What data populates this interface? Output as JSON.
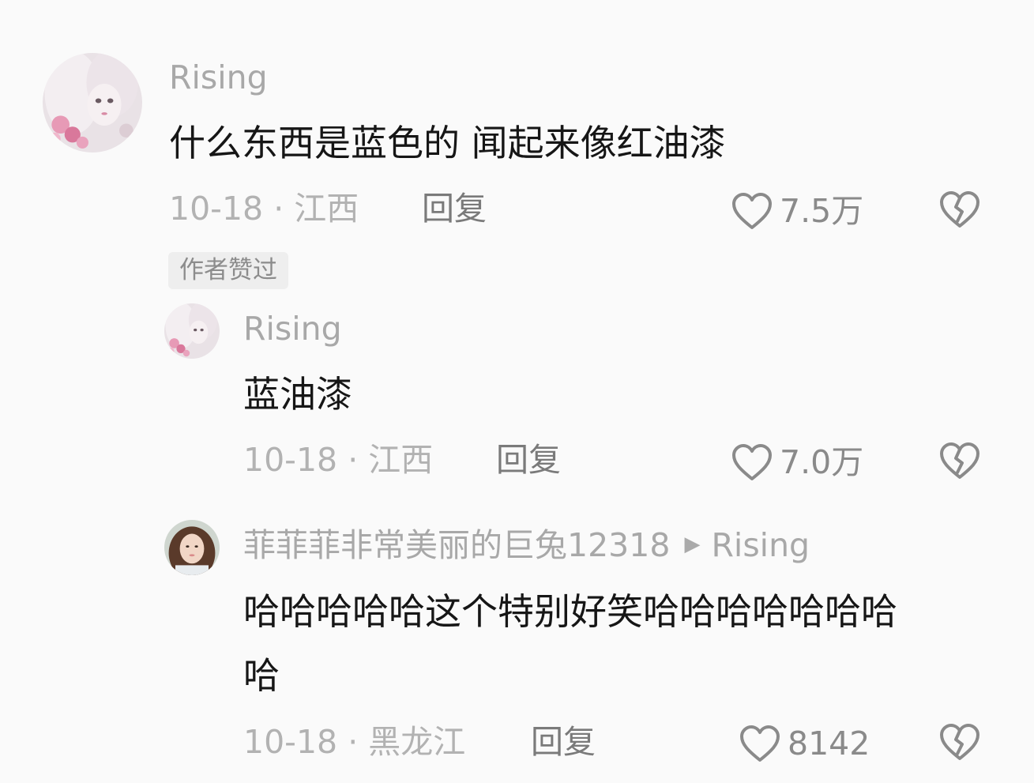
{
  "comments": [
    {
      "username": "Rising",
      "text": "什么东西是蓝色的 闻起来像红油漆",
      "date": "10-18",
      "location": "江西",
      "reply_label": "回复",
      "likes": "7.5万",
      "badge": "作者赞过",
      "avatar_icon": "anime-girl-avatar",
      "colors": {
        "username": "#a8a8a8",
        "text": "#161616",
        "meta": "#b2b2b2"
      }
    },
    {
      "username": "Rising",
      "text": "蓝油漆",
      "date": "10-18",
      "location": "江西",
      "reply_label": "回复",
      "likes": "7.0万",
      "avatar_icon": "anime-girl-avatar"
    },
    {
      "username": "菲菲菲非常美丽的巨兔12318",
      "reply_to": "Rising",
      "text_line1": "哈哈哈哈哈这个特别好笑哈哈哈哈哈哈哈",
      "text_line2": "哈",
      "date": "10-18",
      "location": "黑龙江",
      "reply_label": "回复",
      "likes": "8142",
      "avatar_icon": "girl-photo-avatar"
    }
  ],
  "separator": "·",
  "icons": {
    "like": "heart-outline-icon",
    "dislike": "broken-heart-icon",
    "reply_arrow": "triangle-right-icon"
  }
}
